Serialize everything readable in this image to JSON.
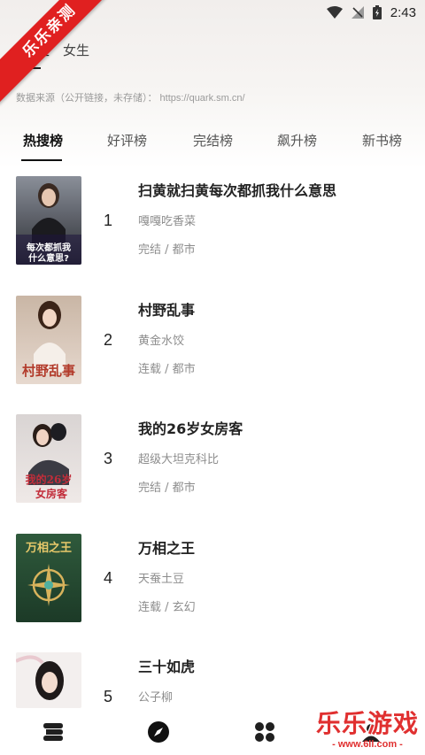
{
  "status_bar": {
    "time": "2:43"
  },
  "ribbon": {
    "text": "乐乐亲测"
  },
  "gender_tabs": [
    {
      "label": "男生",
      "active": true
    },
    {
      "label": "女生",
      "active": false
    }
  ],
  "source": {
    "text": "数据来源（公开链接，未存储）： https://quark.sm.cn/"
  },
  "rank_tabs": [
    {
      "label": "热搜榜",
      "active": true
    },
    {
      "label": "好评榜",
      "active": false
    },
    {
      "label": "完结榜",
      "active": false
    },
    {
      "label": "飙升榜",
      "active": false
    },
    {
      "label": "新书榜",
      "active": false
    }
  ],
  "books": [
    {
      "rank": "1",
      "title": "扫黄就扫黄每次都抓我什么意思",
      "author": "嘎嘎吃香菜",
      "meta": "完结 / 都市",
      "cover_text": "每次都抓我 什么意思？"
    },
    {
      "rank": "2",
      "title": "村野乱事",
      "author": "黄金水饺",
      "meta": "连载 / 都市",
      "cover_text": "村野乱事"
    },
    {
      "rank": "3",
      "title": "我的26岁女房客",
      "author": "超级大坦克科比",
      "meta": "完结 / 都市",
      "cover_text": "我的26岁 女房客"
    },
    {
      "rank": "4",
      "title": "万相之王",
      "author": "天蚕土豆",
      "meta": "连载 / 玄幻",
      "cover_text": "万相之王"
    },
    {
      "rank": "5",
      "title": "三十如虎",
      "author": "公子柳",
      "meta": "",
      "cover_text": ""
    }
  ],
  "bottom_nav": [
    {
      "icon": "bookshelf-icon",
      "active": false
    },
    {
      "icon": "compass-icon",
      "active": true
    },
    {
      "icon": "category-grid-icon",
      "active": false
    },
    {
      "icon": "profile-icon",
      "active": false
    }
  ],
  "watermark": {
    "big": "乐乐游戏",
    "small": "- www.6ll.com -"
  },
  "colors": {
    "ribbon": "#e02020",
    "watermark": "#e03030",
    "active_text": "#111111",
    "muted_text": "#8d8d8d"
  }
}
